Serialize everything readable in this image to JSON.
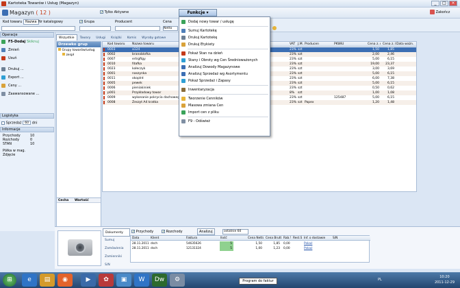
{
  "window": {
    "title": "Kartoteka Towarów i Usług (Magazyn)",
    "minimize": "_",
    "maximize": "□",
    "close": "×"
  },
  "app": {
    "title": "Magazyn",
    "count": "( 12 )",
    "only_active": "Tylko Aktywne",
    "close_label": "Zakończ"
  },
  "filters": {
    "kod_label": "Kod towaru",
    "nazwa_label": "Nazwa",
    "katalog_label": "Nr katalogowy",
    "grupa_label": "Grupa",
    "producent_label": "Producent",
    "cena_label": "Cena",
    "cena_value": "Netto"
  },
  "sidebar": {
    "operacje": "Operacje",
    "items": [
      {
        "label": "F5-Dodaj",
        "extra": "Skiknuj",
        "icon": "add-icon"
      },
      {
        "label": "Zmień",
        "icon": "edit-icon"
      },
      {
        "label": "Usuń",
        "icon": "delete-icon"
      },
      {
        "label": "Drukuj ...",
        "icon": "print-icon"
      },
      {
        "label": "Export ...",
        "icon": "export-icon"
      },
      {
        "label": "Ceny ...",
        "icon": "price-icon"
      },
      {
        "label": "Zaawansowane ...",
        "icon": "advanced-icon"
      }
    ],
    "logistyka": "Logistyka",
    "sprzedaz_label": "Sprzedaż",
    "sprzedaz_value": "60",
    "sprzedaz_unit": "dni",
    "informacje": "Informacje",
    "info": [
      {
        "label": "Przychody",
        "value": "10"
      },
      {
        "label": "Rozchody",
        "value": "0"
      },
      {
        "label": "STAN",
        "value": "10"
      }
    ],
    "polka": "Półka w mag.",
    "zdjecie": "Zdjęcie"
  },
  "tabs": [
    "Wszystkie",
    "Towary",
    "Usługi",
    "Książki",
    "Komis",
    "Wyroby gotowe"
  ],
  "tree": {
    "header": "Drzewko grup",
    "root": "Grupy towarów/usług",
    "child": "zespł"
  },
  "props": {
    "cecha": "Cecha",
    "wartosc": "Wartość"
  },
  "grid": {
    "headers": [
      "Kod towaru",
      "Nazwa towaru",
      "VAT",
      "J.M.",
      "Producent",
      "PKWiU",
      "Cena z. netto",
      "Cena z. brutto",
      "Data ważn."
    ],
    "rows": [
      [
        "0003",
        "a124",
        "23%",
        "szt",
        "",
        "",
        "1,50",
        "1,85",
        ""
      ],
      [
        "0002",
        "branoblofka",
        "23%",
        "szt",
        "",
        "",
        "2,00",
        "2,46",
        ""
      ],
      [
        "0007",
        "ertrgftgy",
        "23%",
        "szt",
        "",
        "",
        "5,00",
        "6,15",
        ""
      ],
      [
        "0010",
        "fdafka",
        "23%",
        "szt",
        "",
        "",
        "19,00",
        "23,37",
        ""
      ],
      [
        "0023",
        "kołeczyk",
        "23%",
        "szt",
        "",
        "",
        "3,00",
        "3,69",
        ""
      ],
      [
        "0001",
        "naszynka",
        "23%",
        "szt",
        "",
        "",
        "5,00",
        "6,15",
        ""
      ],
      [
        "0011",
        "okoplnt",
        "23%",
        "szt",
        "",
        "",
        "6,00",
        "7,38",
        ""
      ],
      [
        "0005",
        "pewek",
        "23%",
        "szt",
        "",
        "",
        "5,00",
        "6,15",
        ""
      ],
      [
        "0006",
        "pieniakiniek",
        "23%",
        "szt",
        "",
        "",
        "0,50",
        "0,62",
        ""
      ],
      [
        "p001",
        "Przykładowy towar",
        "8%",
        "szt",
        "",
        "",
        "1,00",
        "1,08",
        ""
      ],
      [
        "0009",
        "wykonanie pokrycia dachowego",
        "23%",
        "szt",
        "",
        "125487",
        "5,00",
        "6,15",
        ""
      ],
      [
        "0008",
        "Zeszyt A4 kratka",
        "23%",
        "szt",
        "Papex",
        "",
        "1,20",
        "1,48",
        ""
      ]
    ]
  },
  "funkcje_menu": {
    "header": "Funkcje",
    "items": [
      {
        "label": "Dodaj nowy towar / usługę",
        "icon": "add-item-icon"
      },
      {
        "sep": true
      },
      {
        "label": "Sumuj Kartotekę",
        "icon": "sum-icon"
      },
      {
        "label": "Drukuj Kartotekę",
        "icon": "print-icon"
      },
      {
        "label": "Drukuj Etykiety",
        "icon": "label-icon"
      },
      {
        "sep": true
      },
      {
        "label": "Pokaż Stan na dzień",
        "icon": "calendar-icon"
      },
      {
        "label": "Stany i Obroty wg Cen Średnioważonych",
        "icon": "chart-icon"
      },
      {
        "label": "Analizuj Dowody Magazynowe",
        "icon": "analyze-icon"
      },
      {
        "label": "Analizuj Sprzedaż wg Asortymentu",
        "icon": "analyze-icon"
      },
      {
        "label": "Pokaż Sprzedaż i Zapasy",
        "icon": "chart-icon"
      },
      {
        "sep": true
      },
      {
        "label": "Inwentaryzacja",
        "icon": "inventory-icon"
      },
      {
        "sep": true
      },
      {
        "label": "Tworzenie Cenników",
        "icon": "pricelist-icon"
      },
      {
        "label": "Masowa zmiana Cen",
        "icon": "price-icon"
      },
      {
        "label": "Import cen z pliku",
        "icon": "import-icon"
      },
      {
        "sep": true
      },
      {
        "label": "F9 - Odśwież",
        "icon": "refresh-icon"
      }
    ]
  },
  "bottom": {
    "tabs": [
      "Dokumenty",
      "Sumuj",
      "Zamówienia",
      "Zamienniki",
      "S/N"
    ],
    "przychody": "Przychody",
    "rozchody": "Rozchody",
    "analizuj": "Analizuj",
    "period": "ostatnie 60",
    "headers": [
      "Data",
      "Klient",
      "Faktura",
      "Ilość",
      "Cena Netto",
      "Cena Brutto",
      "Rab.%",
      "Rest.S",
      "Inf. o dostawie",
      "S/N"
    ],
    "rows": [
      [
        "28.11.2011",
        "dsch",
        "54635626",
        "5",
        "1,50",
        "1,85",
        "0,00",
        "",
        "Pokaż",
        ""
      ],
      [
        "28.11.2011",
        "dsch",
        "12131324",
        "5",
        "1,00",
        "1,23",
        "0,00",
        "",
        "Pokaż",
        ""
      ]
    ]
  },
  "taskbar": {
    "tooltip": "Program do faktur",
    "lang": "PL",
    "time": "10:20",
    "date": "2011-12-29"
  },
  "colors": {
    "selected_row": "#3c6fb4",
    "alt_row": "#f6efe9",
    "count": "#c43a1a",
    "menu_header": "#a9c3e4"
  }
}
